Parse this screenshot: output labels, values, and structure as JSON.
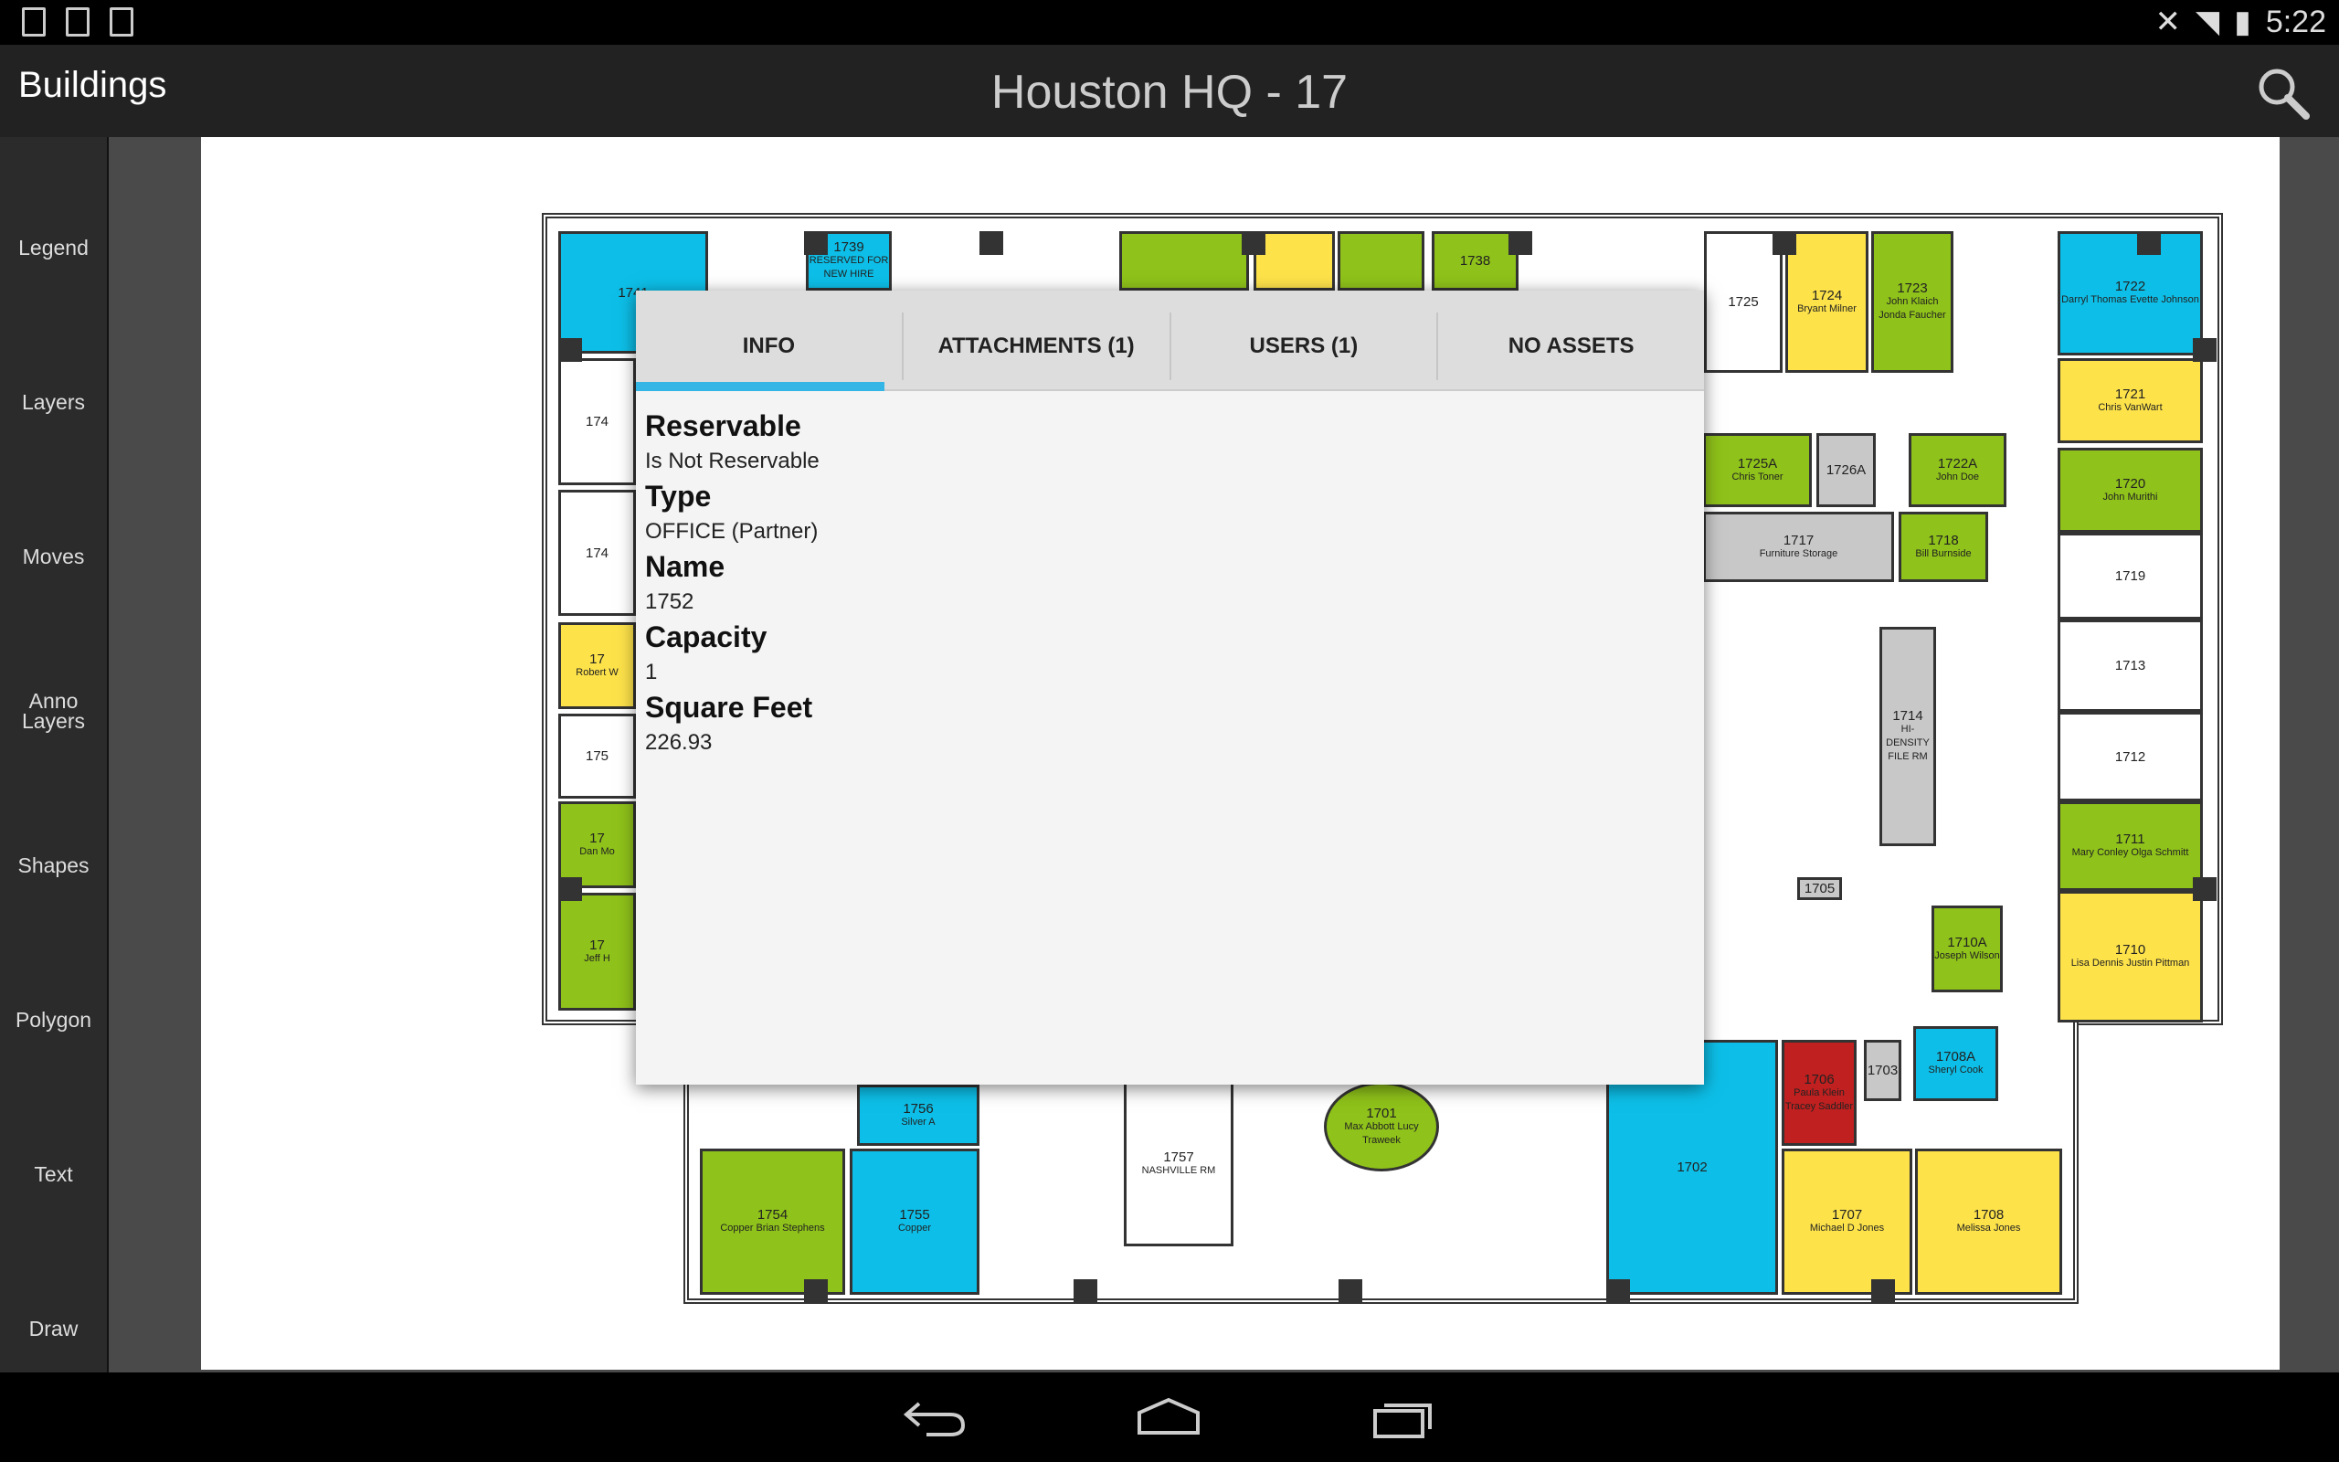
{
  "status_bar": {
    "time": "5:22",
    "icons": [
      "download-icon",
      "image-icon",
      "barcode-icon",
      "mute-icon",
      "wifi-icon",
      "battery-charging-icon"
    ]
  },
  "app_bar": {
    "back_label": "Buildings",
    "title": "Houston HQ - 17",
    "search_icon": "search-icon"
  },
  "sidebar": {
    "items": [
      {
        "label": "Legend",
        "icon": "palette-icon"
      },
      {
        "label": "Layers",
        "icon": "layers-icon"
      },
      {
        "label": "Moves",
        "icon": "move-arrows-icon"
      },
      {
        "label": "Anno Layers",
        "icon": "anno-layers-icon"
      },
      {
        "label": "Shapes",
        "icon": "shapes-icon"
      },
      {
        "label": "Polygon",
        "icon": "polygon-icon"
      },
      {
        "label": "Text",
        "icon": "text-icon"
      },
      {
        "label": "Draw",
        "icon": "brush-icon"
      }
    ]
  },
  "popup": {
    "tabs": [
      {
        "label": "INFO",
        "active": true
      },
      {
        "label": "ATTACHMENTS (1)"
      },
      {
        "label": "USERS (1)"
      },
      {
        "label": "NO ASSETS"
      }
    ],
    "fields": [
      {
        "label": "Reservable",
        "value": "Is Not Reservable"
      },
      {
        "label": "Type",
        "value": "OFFICE (Partner)"
      },
      {
        "label": "Name",
        "value": "1752"
      },
      {
        "label": "Capacity",
        "value": "1"
      },
      {
        "label": "Square Feet",
        "value": "226.93"
      }
    ],
    "accent": "#33b5e5"
  },
  "colors": {
    "blue": "#0dbfe8",
    "green": "#8fc21a",
    "yellow": "#fde24a",
    "gray": "#c8c8c8",
    "red": "#c0201f",
    "white": "#ffffff"
  },
  "floorplan": {
    "rooms": [
      {
        "num": "1724",
        "names": "Bryant Milner",
        "color": "yellow"
      },
      {
        "num": "1723",
        "names": "John Klaich Jonda Faucher",
        "color": "green"
      },
      {
        "num": "1725",
        "names": "",
        "color": "white"
      },
      {
        "num": "1722",
        "names": "Darryl Thomas Evette Johnson",
        "color": "blue"
      },
      {
        "num": "1721",
        "names": "Chris VanWart",
        "color": "yellow"
      },
      {
        "num": "1720",
        "names": "John Murithi",
        "color": "green"
      },
      {
        "num": "1719",
        "names": "",
        "color": "white"
      },
      {
        "num": "1713",
        "names": "",
        "color": "white"
      },
      {
        "num": "1712",
        "names": "",
        "color": "white"
      },
      {
        "num": "1711",
        "names": "Mary Conley Olga Schmitt",
        "color": "green"
      },
      {
        "num": "1710",
        "names": "Lisa Dennis Justin Pittman",
        "color": "yellow"
      },
      {
        "num": "1725A",
        "names": "Chris Toner",
        "color": "green"
      },
      {
        "num": "1726A",
        "names": "",
        "color": "gray"
      },
      {
        "num": "1722A",
        "names": "John Doe",
        "color": "green"
      },
      {
        "num": "1717",
        "names": "Furniture Storage",
        "color": "gray"
      },
      {
        "num": "1718",
        "names": "Bill Burnside",
        "color": "green"
      },
      {
        "num": "1714",
        "names": "HI-DENSITY FILE RM",
        "color": "gray"
      },
      {
        "num": "1705",
        "names": "",
        "color": "gray"
      },
      {
        "num": "1710A",
        "names": "Joseph Wilson",
        "color": "green"
      },
      {
        "num": "1708A",
        "names": "Sheryl Cook",
        "color": "blue"
      },
      {
        "num": "1706",
        "names": "Paula Klein Tracey Saddler",
        "color": "red"
      },
      {
        "num": "1703",
        "names": "",
        "color": "gray"
      },
      {
        "num": "1702",
        "names": "",
        "color": "blue"
      },
      {
        "num": "1707",
        "names": "Michael D Jones",
        "color": "yellow"
      },
      {
        "num": "1708",
        "names": "Melissa Jones",
        "color": "yellow"
      },
      {
        "num": "1701",
        "names": "Max Abbott Lucy Traweek",
        "color": "green"
      },
      {
        "num": "1757",
        "names": "NASHVILLE RM",
        "color": "white"
      },
      {
        "num": "1756",
        "names": "Silver A",
        "color": "blue"
      },
      {
        "num": "1755",
        "names": "Copper",
        "color": "blue"
      },
      {
        "num": "1754",
        "names": "Copper Brian Stephens",
        "color": "green"
      },
      {
        "num": "1741",
        "names": "",
        "color": "blue"
      },
      {
        "num": "1739",
        "names": "RESERVED FOR NEW HIRE",
        "color": "blue"
      },
      {
        "num": "",
        "names": "",
        "color": "green"
      },
      {
        "num": "",
        "names": "",
        "color": "yellow"
      },
      {
        "num": "",
        "names": "",
        "color": "green"
      },
      {
        "num": "1738",
        "names": "",
        "color": "green"
      },
      {
        "num": "174",
        "names": "",
        "color": "white"
      },
      {
        "num": "174",
        "names": "",
        "color": "white"
      },
      {
        "num": "17",
        "names": "Robert W",
        "color": "yellow"
      },
      {
        "num": "175",
        "names": "",
        "color": "white"
      },
      {
        "num": "17",
        "names": "Dan Mo",
        "color": "green"
      },
      {
        "num": "17",
        "names": "Jeff H",
        "color": "green"
      }
    ],
    "markers": [
      {
        "icon": "map-pin-blue-icon",
        "color": "#1e7be0"
      },
      {
        "icon": "map-pin-orange-icon",
        "color": "#f07a18"
      },
      {
        "icon": "map-pin-red-icon",
        "color": "#e81818"
      }
    ]
  },
  "nav_bar": {
    "icons": [
      "back-icon",
      "home-icon",
      "recents-icon"
    ]
  }
}
